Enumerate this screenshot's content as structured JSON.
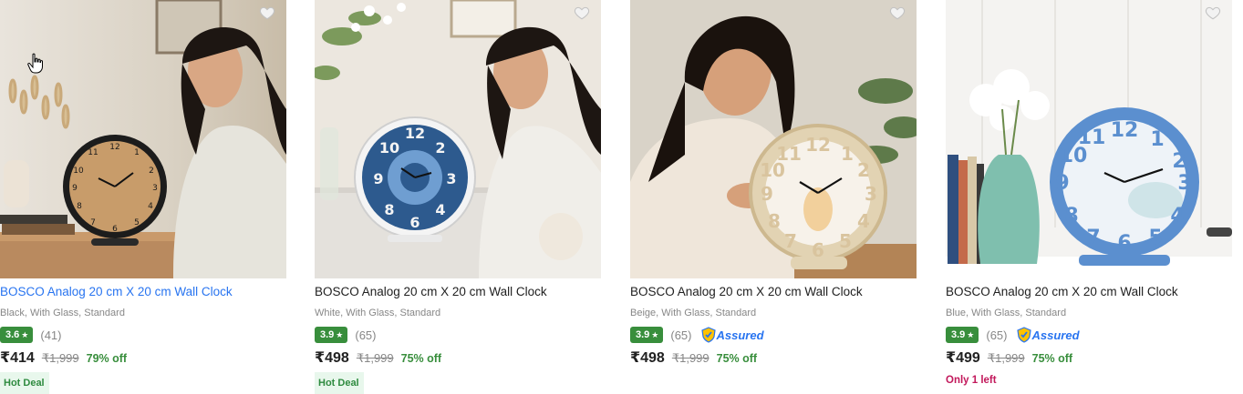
{
  "products": [
    {
      "image": "Woman resting chin on hand beside round black-framed wooden table clock",
      "title": "BOSCO Analog 20 cm X 20 cm Wall Clock",
      "variant": "Black, With Glass, Standard",
      "rating": "3.6",
      "reviews": "(41)",
      "assured": false,
      "price": "₹414",
      "mrp": "₹1,999",
      "discount": "79% off",
      "badge": "Hot Deal",
      "stock_note": ""
    },
    {
      "image": "Woman at marble table with blue mandala-dial white table clock",
      "title": "BOSCO Analog 20 cm X 20 cm Wall Clock",
      "variant": "White, With Glass, Standard",
      "rating": "3.9",
      "reviews": "(65)",
      "assured": false,
      "price": "₹498",
      "mrp": "₹1,999",
      "discount": "75% off",
      "badge": "Hot Deal",
      "stock_note": ""
    },
    {
      "image": "Smiling woman holding beige floral dial table clock",
      "title": "BOSCO Analog 20 cm X 20 cm Wall Clock",
      "variant": "Beige, With Glass, Standard",
      "rating": "3.9",
      "reviews": "(65)",
      "assured": true,
      "assured_label": "Assured",
      "price": "₹498",
      "mrp": "₹1,999",
      "discount": "75% off",
      "badge": "",
      "stock_note": ""
    },
    {
      "image": "Blue table clock beside books and white flowers in teal vase",
      "title": "BOSCO Analog 20 cm X 20 cm Wall Clock",
      "variant": "Blue, With Glass, Standard",
      "rating": "3.9",
      "reviews": "(65)",
      "assured": true,
      "assured_label": "Assured",
      "price": "₹499",
      "mrp": "₹1,999",
      "discount": "75% off",
      "badge": "",
      "stock_note": "Only 1 left"
    }
  ],
  "rating_star": "★",
  "colors": {
    "link_hover": "#2874f0",
    "rating_bg": "#388e3c",
    "discount": "#388e3c",
    "deal_bg": "#e8f7ec",
    "stock": "#c2185b"
  },
  "icons": [
    "heart-outline-icon",
    "star-icon",
    "assured-shield-icon",
    "hand-cursor-icon"
  ]
}
